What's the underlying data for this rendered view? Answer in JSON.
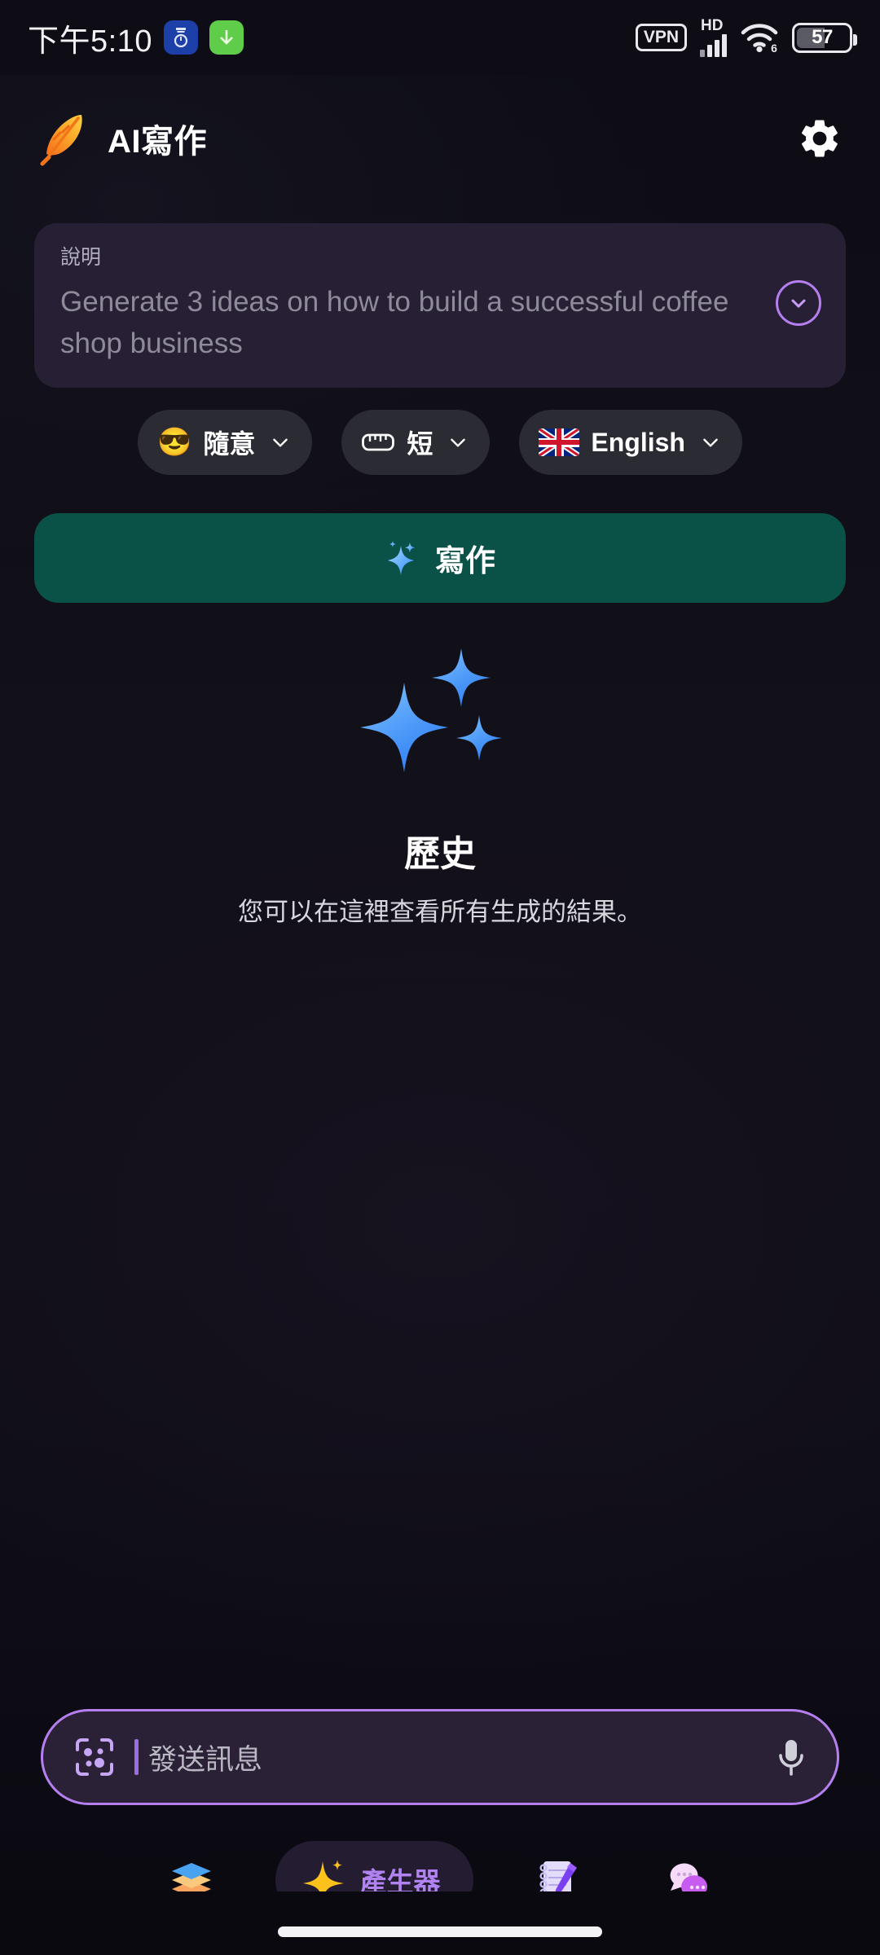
{
  "status_bar": {
    "time": "下午5:10",
    "left_badges": [
      {
        "name": "tally-counter-badge",
        "glyph": "⏱"
      },
      {
        "name": "download-badge",
        "glyph": "↓"
      }
    ],
    "vpn_label": "VPN",
    "network_label": "HD",
    "wifi_generation": "6",
    "battery_percent": "57"
  },
  "header": {
    "title": "AI寫作",
    "feather_icon": "feather-icon",
    "settings_icon": "gear-icon"
  },
  "prompt": {
    "label": "說明",
    "text": "Generate 3 ideas on how to build a successful coffee shop business",
    "expand_icon": "chevron-down-icon"
  },
  "chips": [
    {
      "icon": "sunglasses-emoji",
      "emoji": "😎",
      "label": "隨意",
      "caret": "chevron-down-icon"
    },
    {
      "icon": "ruler-icon",
      "emoji": "",
      "label": "短",
      "caret": "chevron-down-icon"
    },
    {
      "icon": "uk-flag-icon",
      "emoji": "",
      "label": "English",
      "caret": "chevron-down-icon"
    }
  ],
  "write_button": {
    "label": "寫作",
    "icon": "sparkle-icon",
    "color": "#0a5148"
  },
  "empty_state": {
    "illustration": "sparkles-illustration",
    "title": "歷史",
    "subtitle": "您可以在這裡查看所有生成的結果。"
  },
  "input_bar": {
    "scan_icon": "scan-face-icon",
    "placeholder": "發送訊息",
    "value": "",
    "mic_icon": "microphone-icon",
    "accent": "#b57ff0"
  },
  "bottom_nav": {
    "items": [
      {
        "name": "nav-layers",
        "icon": "layers-icon",
        "label": "",
        "active": false
      },
      {
        "name": "nav-generator",
        "icon": "sparkle-icon",
        "label": "產生器",
        "active": true
      },
      {
        "name": "nav-notes",
        "icon": "notepad-pen-icon",
        "label": "",
        "active": false
      },
      {
        "name": "nav-chat",
        "icon": "chat-bubbles-icon",
        "label": "",
        "active": false
      }
    ]
  }
}
